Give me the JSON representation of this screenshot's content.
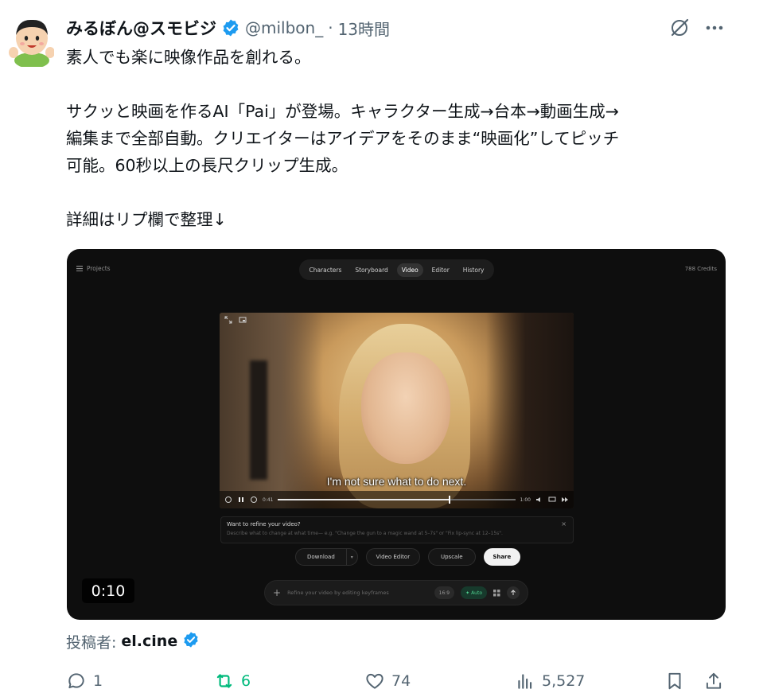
{
  "tweet": {
    "author_name": "みるぼん@スモビジ",
    "handle": "@milbon_",
    "separator": "·",
    "time": "13時間",
    "text_lines": [
      "素人でも楽に映像作品を創れる。",
      "",
      "サクッと映画を作るAI「Pai」が登場。キャラクター生成→台本→動画生成→",
      "編集まで全部自動。クリエイターはアイデアをそのまま“映画化”してピッチ",
      "可能。60秒以上の長尺クリップ生成。",
      "",
      "詳細はリプ欄で整理↓"
    ],
    "attribution_label": "投稿者:",
    "attribution_name": "el.cine"
  },
  "media": {
    "duration": "0:10",
    "app": {
      "projects_label": "Projects",
      "credits": "788 Credits",
      "tabs": [
        {
          "label": "Characters",
          "active": false
        },
        {
          "label": "Storyboard",
          "active": false
        },
        {
          "label": "Video",
          "active": true
        },
        {
          "label": "Editor",
          "active": false
        },
        {
          "label": "History",
          "active": false
        }
      ],
      "player": {
        "subtitle": "I'm not sure what to do next.",
        "time_current": "0:41",
        "time_total": "1:00",
        "progress": 0.72
      },
      "refine": {
        "title": "Want to refine your video?",
        "description": "Describe what to change at what time— e.g. \"Change the gun to a magic wand at 5–7s\" or \"Fix lip-sync at 12–15s\".",
        "close": "×"
      },
      "buttons": {
        "download": "Download",
        "video_editor": "Video Editor",
        "upscale": "Upscale",
        "share": "Share"
      },
      "prompt": {
        "plus": "+",
        "placeholder": "Refine your video by editing keyframes",
        "ratio": "16:9",
        "auto": "Auto"
      }
    }
  },
  "stats": {
    "replies": "1",
    "retweets": "6",
    "likes": "74",
    "views": "5,527"
  },
  "colors": {
    "verified": "#1d9bf0",
    "retweet": "#00ba7c",
    "muted": "#536471"
  }
}
